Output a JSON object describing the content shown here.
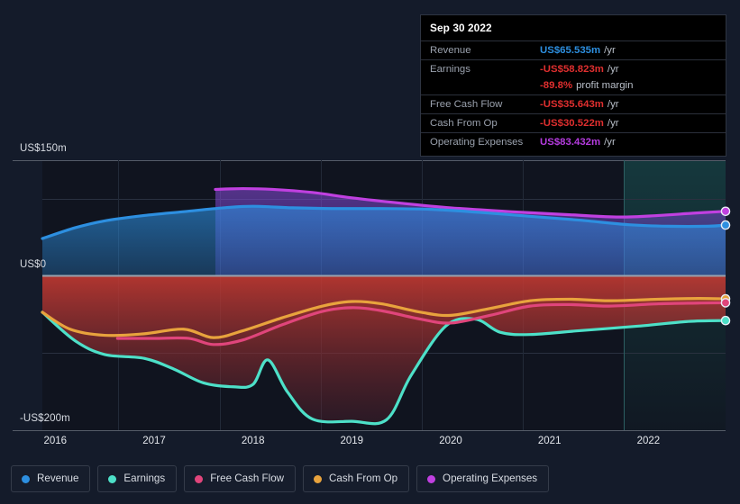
{
  "tooltip": {
    "date": "Sep 30 2022",
    "rows": [
      {
        "label": "Revenue",
        "value": "US$65.535m",
        "suffix": "/yr",
        "color": "#2d8fe0",
        "rule": true
      },
      {
        "label": "Earnings",
        "value": "-US$58.823m",
        "suffix": "/yr",
        "color": "#e02f2f",
        "rule": true
      },
      {
        "label": "",
        "value": "-89.8%",
        "suffix": "profit margin",
        "color": "#e02f2f",
        "rule": false
      },
      {
        "label": "Free Cash Flow",
        "value": "-US$35.643m",
        "suffix": "/yr",
        "color": "#e02f2f",
        "rule": true
      },
      {
        "label": "Cash From Op",
        "value": "-US$30.522m",
        "suffix": "/yr",
        "color": "#e02f2f",
        "rule": true
      },
      {
        "label": "Operating Expenses",
        "value": "US$83.432m",
        "suffix": "/yr",
        "color": "#b63ce0",
        "rule": true
      }
    ]
  },
  "legend": {
    "items": [
      {
        "label": "Revenue",
        "color": "#2d8fe0"
      },
      {
        "label": "Earnings",
        "color": "#4de0c8"
      },
      {
        "label": "Free Cash Flow",
        "color": "#e0457b"
      },
      {
        "label": "Cash From Op",
        "color": "#e8a33d"
      },
      {
        "label": "Operating Expenses",
        "color": "#c040e0"
      }
    ]
  },
  "axes": {
    "y_top_label": "US$150m",
    "y_zero_label": "US$0",
    "y_bottom_label": "-US$200m",
    "x_labels": [
      "2016",
      "2017",
      "2018",
      "2019",
      "2020",
      "2021",
      "2022"
    ]
  },
  "chart_data": {
    "type": "area",
    "title": "",
    "xlabel": "",
    "ylabel": "US$",
    "ylim": [
      -200,
      150
    ],
    "ytick_values": [
      150,
      0,
      -200
    ],
    "ytick_labels": [
      "US$150m",
      "US$0",
      "-US$200m"
    ],
    "x": [
      "2016",
      "2017",
      "2018",
      "2019",
      "2020",
      "2021",
      "2022"
    ],
    "xlim": [
      "2015.85",
      "2022.9"
    ],
    "grid": true,
    "legend_position": "bottom",
    "forecast_region_start": "2021.75",
    "series": [
      {
        "name": "Revenue",
        "color": "#2d8fe0",
        "unit": "US$m",
        "points": [
          {
            "t": 2015.87,
            "v": 48
          },
          {
            "t": 2016.2,
            "v": 62
          },
          {
            "t": 2016.5,
            "v": 71
          },
          {
            "t": 2016.9,
            "v": 78
          },
          {
            "t": 2017.3,
            "v": 83
          },
          {
            "t": 2017.7,
            "v": 88
          },
          {
            "t": 2018.0,
            "v": 90
          },
          {
            "t": 2018.4,
            "v": 88
          },
          {
            "t": 2018.8,
            "v": 87
          },
          {
            "t": 2019.3,
            "v": 87
          },
          {
            "t": 2019.8,
            "v": 86
          },
          {
            "t": 2020.3,
            "v": 82
          },
          {
            "t": 2020.8,
            "v": 77
          },
          {
            "t": 2021.3,
            "v": 72
          },
          {
            "t": 2021.8,
            "v": 66
          },
          {
            "t": 2022.2,
            "v": 64
          },
          {
            "t": 2022.6,
            "v": 64
          },
          {
            "t": 2022.78,
            "v": 65.535
          }
        ]
      },
      {
        "name": "Operating Expenses",
        "color": "#c040e0",
        "unit": "US$m",
        "points": [
          {
            "t": 2017.62,
            "v": 112
          },
          {
            "t": 2017.9,
            "v": 113
          },
          {
            "t": 2018.2,
            "v": 112
          },
          {
            "t": 2018.6,
            "v": 108
          },
          {
            "t": 2019.0,
            "v": 101
          },
          {
            "t": 2019.5,
            "v": 94
          },
          {
            "t": 2020.0,
            "v": 88
          },
          {
            "t": 2020.6,
            "v": 83
          },
          {
            "t": 2021.2,
            "v": 79
          },
          {
            "t": 2021.7,
            "v": 76
          },
          {
            "t": 2022.1,
            "v": 78
          },
          {
            "t": 2022.45,
            "v": 81
          },
          {
            "t": 2022.78,
            "v": 83.432
          }
        ]
      },
      {
        "name": "Earnings",
        "color": "#4de0c8",
        "unit": "US$m",
        "points": [
          {
            "t": 2015.87,
            "v": -48
          },
          {
            "t": 2016.2,
            "v": -85
          },
          {
            "t": 2016.5,
            "v": -103
          },
          {
            "t": 2016.9,
            "v": -108
          },
          {
            "t": 2017.2,
            "v": -122
          },
          {
            "t": 2017.5,
            "v": -140
          },
          {
            "t": 2017.8,
            "v": -145
          },
          {
            "t": 2018.0,
            "v": -142
          },
          {
            "t": 2018.15,
            "v": -110
          },
          {
            "t": 2018.35,
            "v": -152
          },
          {
            "t": 2018.6,
            "v": -187
          },
          {
            "t": 2019.0,
            "v": -190
          },
          {
            "t": 2019.35,
            "v": -188
          },
          {
            "t": 2019.6,
            "v": -130
          },
          {
            "t": 2019.95,
            "v": -66
          },
          {
            "t": 2020.25,
            "v": -57
          },
          {
            "t": 2020.5,
            "v": -74
          },
          {
            "t": 2020.8,
            "v": -77
          },
          {
            "t": 2021.3,
            "v": -72
          },
          {
            "t": 2021.9,
            "v": -66
          },
          {
            "t": 2022.4,
            "v": -60
          },
          {
            "t": 2022.78,
            "v": -58.823
          }
        ]
      },
      {
        "name": "Cash From Op",
        "color": "#e8a33d",
        "unit": "US$m",
        "points": [
          {
            "t": 2015.87,
            "v": -48
          },
          {
            "t": 2016.15,
            "v": -70
          },
          {
            "t": 2016.5,
            "v": -78
          },
          {
            "t": 2016.9,
            "v": -76
          },
          {
            "t": 2017.3,
            "v": -70
          },
          {
            "t": 2017.6,
            "v": -81
          },
          {
            "t": 2017.9,
            "v": -72
          },
          {
            "t": 2018.3,
            "v": -55
          },
          {
            "t": 2018.7,
            "v": -40
          },
          {
            "t": 2019.0,
            "v": -34
          },
          {
            "t": 2019.3,
            "v": -37
          },
          {
            "t": 2019.7,
            "v": -48
          },
          {
            "t": 2020.0,
            "v": -52
          },
          {
            "t": 2020.4,
            "v": -43
          },
          {
            "t": 2020.8,
            "v": -33
          },
          {
            "t": 2021.2,
            "v": -31
          },
          {
            "t": 2021.6,
            "v": -33
          },
          {
            "t": 2022.1,
            "v": -31
          },
          {
            "t": 2022.5,
            "v": -30
          },
          {
            "t": 2022.78,
            "v": -30.522
          }
        ]
      },
      {
        "name": "Free Cash Flow",
        "color": "#e0457b",
        "unit": "US$m",
        "points": [
          {
            "t": 2016.63,
            "v": -82
          },
          {
            "t": 2017.0,
            "v": -82
          },
          {
            "t": 2017.35,
            "v": -82
          },
          {
            "t": 2017.6,
            "v": -90
          },
          {
            "t": 2017.9,
            "v": -84
          },
          {
            "t": 2018.3,
            "v": -64
          },
          {
            "t": 2018.7,
            "v": -47
          },
          {
            "t": 2019.0,
            "v": -42
          },
          {
            "t": 2019.3,
            "v": -46
          },
          {
            "t": 2019.7,
            "v": -57
          },
          {
            "t": 2020.0,
            "v": -62
          },
          {
            "t": 2020.4,
            "v": -52
          },
          {
            "t": 2020.8,
            "v": -40
          },
          {
            "t": 2021.2,
            "v": -38
          },
          {
            "t": 2021.6,
            "v": -40
          },
          {
            "t": 2022.1,
            "v": -37
          },
          {
            "t": 2022.5,
            "v": -36
          },
          {
            "t": 2022.78,
            "v": -35.643
          }
        ]
      }
    ]
  }
}
